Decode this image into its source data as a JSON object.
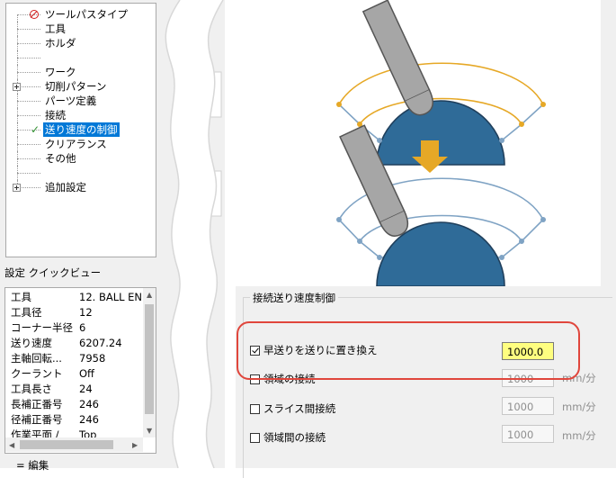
{
  "tree": {
    "items": [
      {
        "label": "ツールパスタイプ",
        "icon": "no-entry-icon"
      },
      {
        "label": "工具"
      },
      {
        "label": "ホルダ"
      },
      {
        "label": ""
      },
      {
        "label": "ワーク"
      },
      {
        "label": "切削パターン",
        "expandable": true
      },
      {
        "label": "パーツ定義"
      },
      {
        "label": "接続"
      },
      {
        "label": "送り速度の制御",
        "icon": "checkmark-icon",
        "selected": true
      },
      {
        "label": "クリアランス"
      },
      {
        "label": "その他"
      },
      {
        "label": ""
      },
      {
        "label": "追加設定",
        "expandable": true
      }
    ]
  },
  "quickview": {
    "title": "設定 クイックビュー",
    "rows": [
      {
        "key": "工具",
        "value": "12. BALL EN"
      },
      {
        "key": "工具径",
        "value": "12"
      },
      {
        "key": "コーナー半径",
        "value": "6"
      },
      {
        "key": "送り速度",
        "value": "6207.24"
      },
      {
        "key": "主軸回転...",
        "value": "7958"
      },
      {
        "key": "クーラント",
        "value": "Off"
      },
      {
        "key": "工具長さ",
        "value": "24"
      },
      {
        "key": "長補正番号",
        "value": "246"
      },
      {
        "key": "径補正番号",
        "value": "246"
      },
      {
        "key": "作業平面 /",
        "value": "Top"
      }
    ],
    "bottom_label": "= 編集"
  },
  "connection_feed": {
    "group_title": "接続送り速度制御",
    "options": [
      {
        "label": "早送りを送りに置き換え",
        "checked": true,
        "value": "1000.0",
        "unit": "",
        "enabled": true
      },
      {
        "label": "領域の接続",
        "checked": false,
        "value": "1000",
        "unit": "mm/分",
        "enabled": false
      },
      {
        "label": "スライス間接続",
        "checked": false,
        "value": "1000",
        "unit": "mm/分",
        "enabled": false
      },
      {
        "label": "領域間の接続",
        "checked": false,
        "value": "1000",
        "unit": "mm/分",
        "enabled": false
      }
    ]
  },
  "colors": {
    "accent_select": "#0078d7",
    "rapid_path": "#e6a826",
    "feed_path": "#7fa3c4",
    "part_fill": "#2f6b98",
    "tool_fill": "#a6a6a6",
    "active_field": "#ffff80",
    "highlight": "#e0463c"
  }
}
